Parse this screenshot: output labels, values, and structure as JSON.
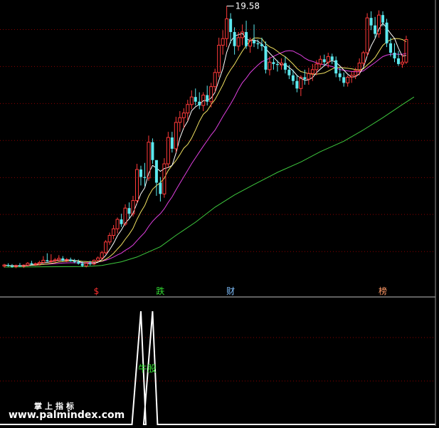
{
  "colors": {
    "background": "#000000",
    "grid": "#8b0000",
    "up": "#ff3a3a",
    "down": "#5ce8ee",
    "ma_fast": "#ffffff",
    "ma_mid": "#f0e060",
    "ma_slow": "#e040e0",
    "ma_long": "#3ec83e",
    "indicator": "#ffffff",
    "signal_s": "#ff3030",
    "signal_die": "#33dd33",
    "signal_cai": "#80c0ff",
    "signal_bang": "#ff9966",
    "niu_label": "#33dd33"
  },
  "chart_data": [
    {
      "type": "candlestick",
      "max_label": "19.58",
      "max_value": 19.58,
      "ylim": [
        5.0,
        19.9
      ],
      "grid": true,
      "gridlines": [
        18.33,
        16.37,
        14.4,
        12.44,
        10.47,
        8.51,
        6.54
      ],
      "candles": [
        [
          5.77,
          5.89,
          5.69,
          5.83
        ],
        [
          5.83,
          5.92,
          5.74,
          5.78
        ],
        [
          5.78,
          5.88,
          5.68,
          5.74
        ],
        [
          5.74,
          5.85,
          5.66,
          5.8
        ],
        [
          5.8,
          5.93,
          5.72,
          5.76
        ],
        [
          5.76,
          5.86,
          5.67,
          5.82
        ],
        [
          5.82,
          5.98,
          5.75,
          5.92
        ],
        [
          5.92,
          6.05,
          5.83,
          5.86
        ],
        [
          5.86,
          5.96,
          5.78,
          5.9
        ],
        [
          5.9,
          6.05,
          5.8,
          5.96
        ],
        [
          5.96,
          6.3,
          5.9,
          6.08
        ],
        [
          6.08,
          6.45,
          6.0,
          6.02
        ],
        [
          6.02,
          6.4,
          5.95,
          6.05
        ],
        [
          6.05,
          6.2,
          5.96,
          6.1
        ],
        [
          6.1,
          6.35,
          6.02,
          6.18
        ],
        [
          6.18,
          6.3,
          6.02,
          6.06
        ],
        [
          6.06,
          6.2,
          5.98,
          6.12
        ],
        [
          6.12,
          6.22,
          6.0,
          6.03
        ],
        [
          6.03,
          6.15,
          5.92,
          5.98
        ],
        [
          5.98,
          6.12,
          5.85,
          5.9
        ],
        [
          5.9,
          6.02,
          5.72,
          5.78
        ],
        [
          5.78,
          5.98,
          5.7,
          5.92
        ],
        [
          5.92,
          6.05,
          5.8,
          5.88
        ],
        [
          5.88,
          6.12,
          5.82,
          6.08
        ],
        [
          6.08,
          6.28,
          6.0,
          6.2
        ],
        [
          6.2,
          6.58,
          6.1,
          6.48
        ],
        [
          6.48,
          7.15,
          6.4,
          7.05
        ],
        [
          7.05,
          7.55,
          6.9,
          7.4
        ],
        [
          7.4,
          7.95,
          7.2,
          7.75
        ],
        [
          7.75,
          8.35,
          7.5,
          8.25
        ],
        [
          8.25,
          8.55,
          7.85,
          8.0
        ],
        [
          8.0,
          9.05,
          7.9,
          8.85
        ],
        [
          8.85,
          9.15,
          8.3,
          8.55
        ],
        [
          8.55,
          9.5,
          8.4,
          9.25
        ],
        [
          9.25,
          11.2,
          9.1,
          10.9
        ],
        [
          10.9,
          11.1,
          10.05,
          10.5
        ],
        [
          10.5,
          11.25,
          10.0,
          10.45
        ],
        [
          10.45,
          12.7,
          10.3,
          12.35
        ],
        [
          12.35,
          12.55,
          11.2,
          11.4
        ],
        [
          11.4,
          10.6,
          9.5,
          10.2
        ],
        [
          10.2,
          10.5,
          9.2,
          9.6
        ],
        [
          9.6,
          11.5,
          9.4,
          11.2
        ],
        [
          11.2,
          12.9,
          11.0,
          12.6
        ],
        [
          12.6,
          12.9,
          11.8,
          12.0
        ],
        [
          12.0,
          13.7,
          11.8,
          13.4
        ],
        [
          13.4,
          14.0,
          12.9,
          13.65
        ],
        [
          13.65,
          14.15,
          13.1,
          13.9
        ],
        [
          13.9,
          14.6,
          13.5,
          14.35
        ],
        [
          14.35,
          15.1,
          14.1,
          14.75
        ],
        [
          14.75,
          15.2,
          14.3,
          14.5
        ],
        [
          14.5,
          15.0,
          14.1,
          14.3
        ],
        [
          14.3,
          15.0,
          14.0,
          14.85
        ],
        [
          14.85,
          15.35,
          14.3,
          14.5
        ],
        [
          14.5,
          15.5,
          14.2,
          15.3
        ],
        [
          15.3,
          16.25,
          15.0,
          16.05
        ],
        [
          16.05,
          17.9,
          15.8,
          17.5
        ],
        [
          17.5,
          18.3,
          17.0,
          17.85
        ],
        [
          17.85,
          19.58,
          17.4,
          18.9
        ],
        [
          18.9,
          19.2,
          17.6,
          18.2
        ],
        [
          18.2,
          18.45,
          17.0,
          17.45
        ],
        [
          17.45,
          18.2,
          17.2,
          17.9
        ],
        [
          17.9,
          18.6,
          17.5,
          18.2
        ],
        [
          18.2,
          18.8,
          17.3,
          17.45
        ],
        [
          17.45,
          17.9,
          17.1,
          17.75
        ],
        [
          17.75,
          18.6,
          17.4,
          17.6
        ],
        [
          17.6,
          17.8,
          17.3,
          17.55
        ],
        [
          17.55,
          17.9,
          17.2,
          17.45
        ],
        [
          17.45,
          17.7,
          16.0,
          16.2
        ],
        [
          16.2,
          16.9,
          15.9,
          16.6
        ],
        [
          16.6,
          16.8,
          16.2,
          16.5
        ],
        [
          16.5,
          16.7,
          16.1,
          16.45
        ],
        [
          16.45,
          16.8,
          16.2,
          16.55
        ],
        [
          16.55,
          16.9,
          16.0,
          16.2
        ],
        [
          16.2,
          16.45,
          15.7,
          15.9
        ],
        [
          15.9,
          16.2,
          15.4,
          15.6
        ],
        [
          15.6,
          15.9,
          15.0,
          15.2
        ],
        [
          15.2,
          15.9,
          14.8,
          15.8
        ],
        [
          15.8,
          16.2,
          15.4,
          15.7
        ],
        [
          15.7,
          16.3,
          15.4,
          16.0
        ],
        [
          16.0,
          16.5,
          15.6,
          16.2
        ],
        [
          16.2,
          16.7,
          15.9,
          16.5
        ],
        [
          16.5,
          16.95,
          16.3,
          16.75
        ],
        [
          16.75,
          17.0,
          16.4,
          16.6
        ],
        [
          16.6,
          17.1,
          16.3,
          16.9
        ],
        [
          16.9,
          17.05,
          16.5,
          16.7
        ],
        [
          16.7,
          16.9,
          15.8,
          16.0
        ],
        [
          16.0,
          16.3,
          15.6,
          15.8
        ],
        [
          15.8,
          16.05,
          15.3,
          15.5
        ],
        [
          15.5,
          15.9,
          15.3,
          15.8
        ],
        [
          15.8,
          16.1,
          15.5,
          15.9
        ],
        [
          15.9,
          16.3,
          15.7,
          16.15
        ],
        [
          16.15,
          16.8,
          15.9,
          16.55
        ],
        [
          16.55,
          17.2,
          16.4,
          17.1
        ],
        [
          17.1,
          19.2,
          16.9,
          18.95
        ],
        [
          18.95,
          19.3,
          18.3,
          18.55
        ],
        [
          18.55,
          19.0,
          17.9,
          18.1
        ],
        [
          18.1,
          19.35,
          17.9,
          19.1
        ],
        [
          19.1,
          19.3,
          18.5,
          18.7
        ],
        [
          18.7,
          18.9,
          17.4,
          17.6
        ],
        [
          17.6,
          17.9,
          16.9,
          17.1
        ],
        [
          17.1,
          17.6,
          16.6,
          16.8
        ],
        [
          16.8,
          17.2,
          16.4,
          16.5
        ],
        [
          16.5,
          17.0,
          16.3,
          16.6
        ],
        [
          16.6,
          18.0,
          16.5,
          17.8
        ]
      ],
      "ma_long_points": [
        [
          0,
          5.72
        ],
        [
          21,
          5.75
        ],
        [
          25,
          5.8
        ],
        [
          30,
          6.0
        ],
        [
          34,
          6.25
        ],
        [
          40,
          6.8
        ],
        [
          44,
          7.4
        ],
        [
          49,
          8.1
        ],
        [
          54,
          8.9
        ],
        [
          59,
          9.55
        ],
        [
          64,
          10.1
        ],
        [
          70,
          10.75
        ],
        [
          76,
          11.3
        ],
        [
          81,
          11.85
        ],
        [
          87,
          12.4
        ],
        [
          92,
          13.0
        ],
        [
          97,
          13.65
        ],
        [
          102,
          14.35
        ],
        [
          105,
          14.75
        ]
      ]
    },
    {
      "type": "line",
      "signals": [
        {
          "index": 24,
          "label": "$"
        },
        {
          "index": 40,
          "label": "跌"
        },
        {
          "index": 58,
          "label": "财"
        },
        {
          "index": 97,
          "label": "榜"
        }
      ],
      "label": "牛股",
      "spike_indices": [
        35,
        38
      ],
      "ylim": [
        0,
        1
      ]
    }
  ],
  "watermark": {
    "text_cn": "掌上指标",
    "url": "www.palmindex.com"
  }
}
